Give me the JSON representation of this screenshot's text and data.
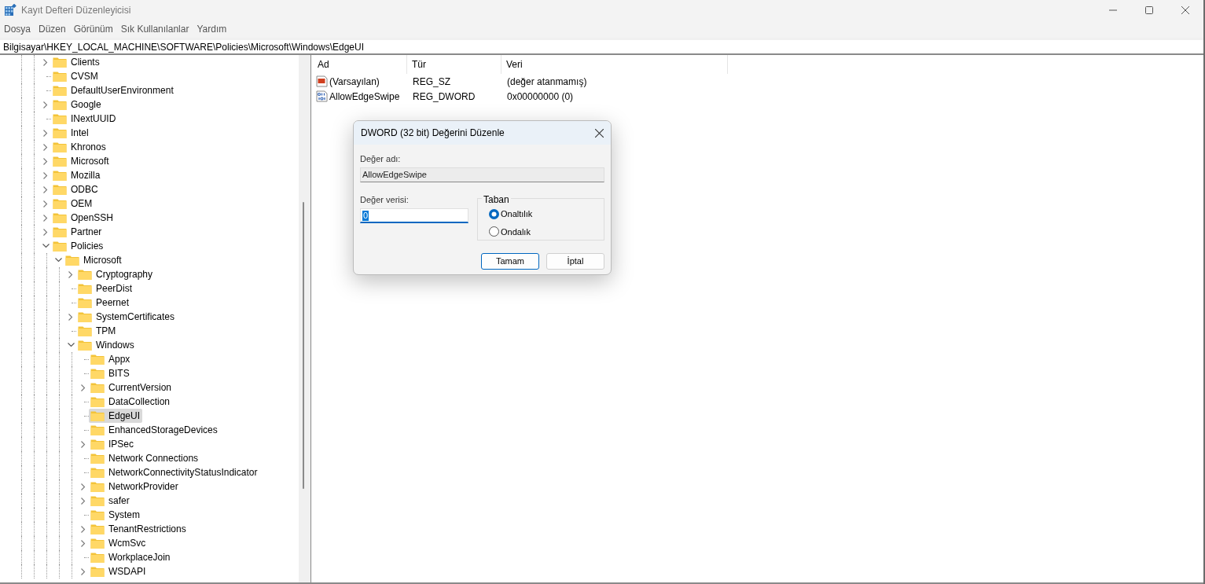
{
  "window": {
    "title": "Kayıt Defteri Düzenleyicisi"
  },
  "menu": [
    "Dosya",
    "Düzen",
    "Görünüm",
    "Sık Kullanılanlar",
    "Yardım"
  ],
  "address_bar": "Bilgisayar\\HKEY_LOCAL_MACHINE\\SOFTWARE\\Policies\\Microsoft\\Windows\\EdgeUI",
  "tree": [
    {
      "label": "Clients",
      "kind": "collapsed",
      "selected": false
    },
    {
      "label": "CVSM",
      "kind": "leaf",
      "selected": false
    },
    {
      "label": "DefaultUserEnvironment",
      "kind": "leaf",
      "selected": false
    },
    {
      "label": "Google",
      "kind": "collapsed",
      "selected": false
    },
    {
      "label": "INextUUID",
      "kind": "leaf",
      "selected": false
    },
    {
      "label": "Intel",
      "kind": "collapsed",
      "selected": false
    },
    {
      "label": "Khronos",
      "kind": "collapsed",
      "selected": false
    },
    {
      "label": "Microsoft",
      "kind": "collapsed",
      "selected": false
    },
    {
      "label": "Mozilla",
      "kind": "collapsed",
      "selected": false
    },
    {
      "label": "ODBC",
      "kind": "collapsed",
      "selected": false
    },
    {
      "label": "OEM",
      "kind": "collapsed",
      "selected": false
    },
    {
      "label": "OpenSSH",
      "kind": "collapsed",
      "selected": false
    },
    {
      "label": "Partner",
      "kind": "collapsed",
      "selected": false
    },
    {
      "label": "Policies",
      "kind": "expanded",
      "selected": false,
      "children": [
        {
          "label": "Microsoft",
          "kind": "expanded",
          "selected": false,
          "children": [
            {
              "label": "Cryptography",
              "kind": "collapsed",
              "selected": false
            },
            {
              "label": "PeerDist",
              "kind": "leaf",
              "selected": false
            },
            {
              "label": "Peernet",
              "kind": "leaf",
              "selected": false
            },
            {
              "label": "SystemCertificates",
              "kind": "collapsed",
              "selected": false
            },
            {
              "label": "TPM",
              "kind": "leaf",
              "selected": false
            },
            {
              "label": "Windows",
              "kind": "expanded",
              "selected": false,
              "children": [
                {
                  "label": "Appx",
                  "kind": "leaf",
                  "selected": false
                },
                {
                  "label": "BITS",
                  "kind": "leaf",
                  "selected": false
                },
                {
                  "label": "CurrentVersion",
                  "kind": "collapsed",
                  "selected": false
                },
                {
                  "label": "DataCollection",
                  "kind": "leaf",
                  "selected": false
                },
                {
                  "label": "EdgeUI",
                  "kind": "leaf",
                  "selected": true
                },
                {
                  "label": "EnhancedStorageDevices",
                  "kind": "leaf",
                  "selected": false
                },
                {
                  "label": "IPSec",
                  "kind": "collapsed",
                  "selected": false
                },
                {
                  "label": "Network Connections",
                  "kind": "leaf",
                  "selected": false
                },
                {
                  "label": "NetworkConnectivityStatusIndicator",
                  "kind": "leaf",
                  "selected": false
                },
                {
                  "label": "NetworkProvider",
                  "kind": "collapsed",
                  "selected": false
                },
                {
                  "label": "safer",
                  "kind": "collapsed",
                  "selected": false
                },
                {
                  "label": "System",
                  "kind": "leaf",
                  "selected": false
                },
                {
                  "label": "TenantRestrictions",
                  "kind": "collapsed",
                  "selected": false
                },
                {
                  "label": "WcmSvc",
                  "kind": "collapsed",
                  "selected": false
                },
                {
                  "label": "WorkplaceJoin",
                  "kind": "leaf",
                  "selected": false
                },
                {
                  "label": "WSDAPI",
                  "kind": "collapsed",
                  "selected": false
                }
              ]
            }
          ]
        }
      ]
    }
  ],
  "table": {
    "columns": [
      "Ad",
      "Tür",
      "Veri"
    ],
    "rows": [
      {
        "kind": "string",
        "name": "(Varsayılan)",
        "type": "REG_SZ",
        "data": "(değer atanmamış)"
      },
      {
        "kind": "binary",
        "name": "AllowEdgeSwipe",
        "type": "REG_DWORD",
        "data": "0x00000000 (0)"
      }
    ]
  },
  "dialog": {
    "title": "DWORD (32 bit) Değerini Düzenle",
    "name_label": "Değer adı:",
    "name_value": "AllowEdgeSwipe",
    "data_label": "Değer verisi:",
    "data_value": "0",
    "base_label": "Taban",
    "base_options": [
      {
        "label": "Onaltılık",
        "selected": true
      },
      {
        "label": "Ondalık",
        "selected": false
      }
    ],
    "buttons": [
      {
        "label": "Tamam",
        "kind": "default"
      },
      {
        "label": "İptal",
        "kind": "normal"
      }
    ]
  }
}
